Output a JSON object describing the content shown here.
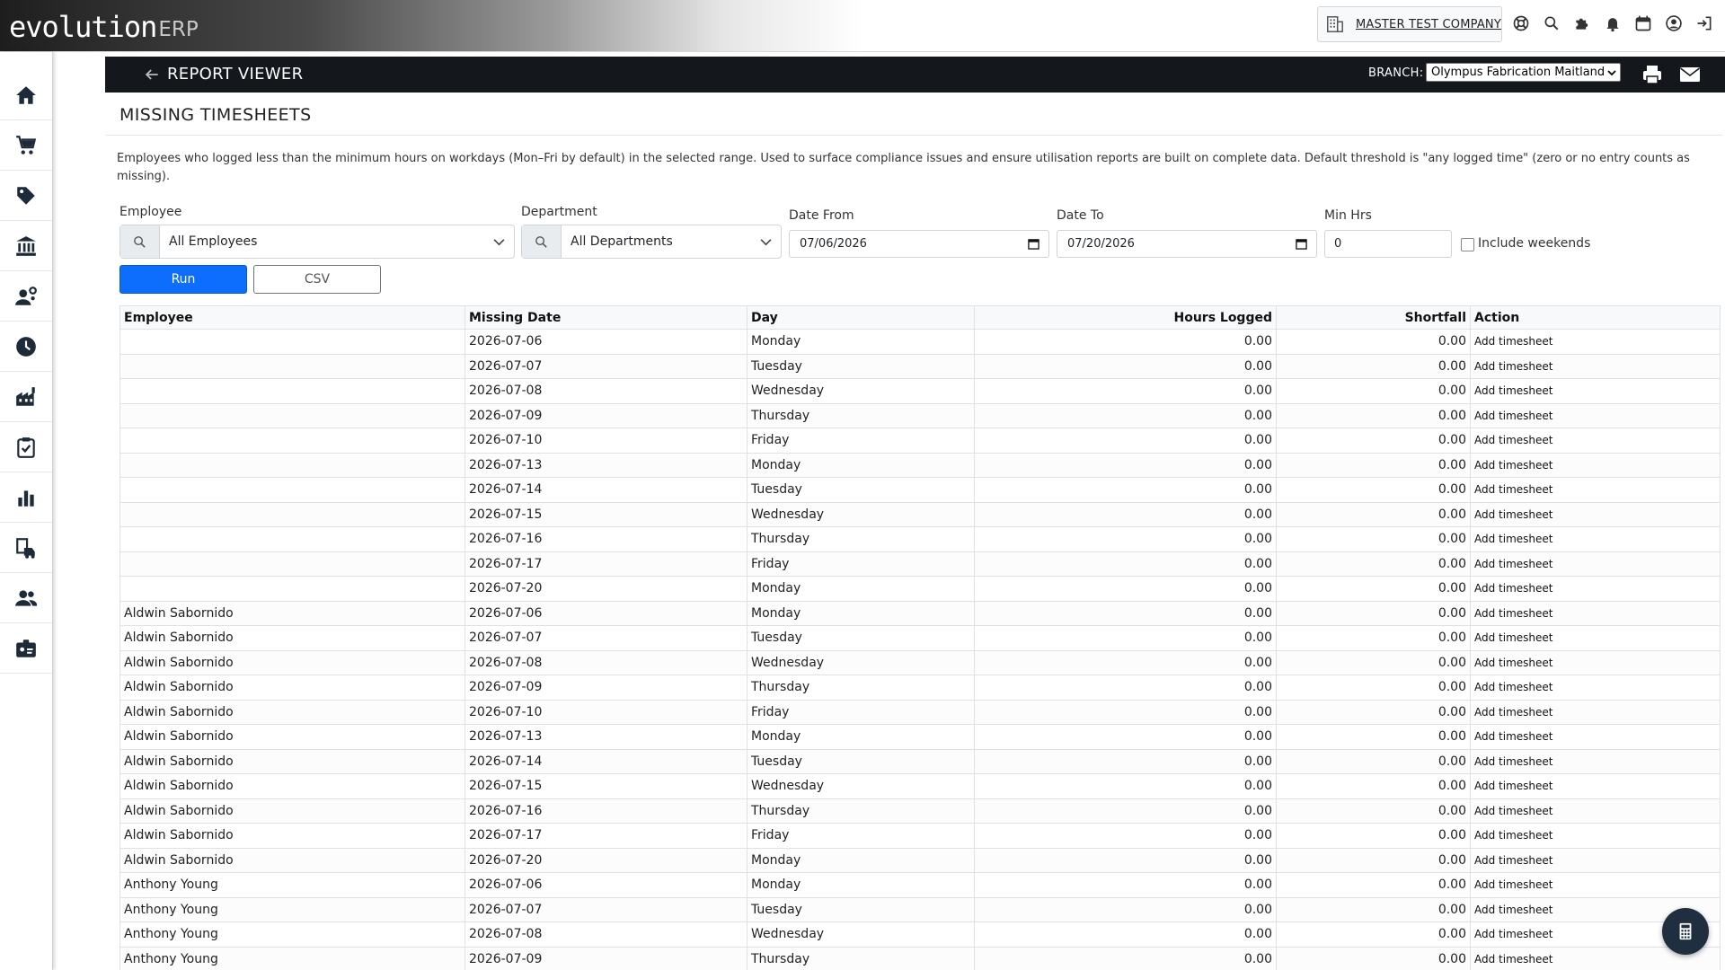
{
  "app": {
    "logo_main": "evolution",
    "logo_suffix": "ERP",
    "company": "MASTER TEST COMPANY"
  },
  "header": {
    "title": "REPORT VIEWER",
    "branch_label": "BRANCH:",
    "branch_value": "Olympus Fabrication Maitland"
  },
  "report": {
    "title": "MISSING TIMESHEETS",
    "description": "Employees who logged less than the minimum hours on workdays (Mon–Fri by default) in the selected range. Used to surface compliance issues and ensure utilisation reports are built on complete data. Default threshold is \"any logged time\" (zero or no entry counts as missing)."
  },
  "filters": {
    "employee_label": "Employee",
    "employee_value": "All Employees",
    "department_label": "Department",
    "department_value": "All Departments",
    "date_from_label": "Date From",
    "date_from_value": "07/06/2026",
    "date_to_label": "Date To",
    "date_to_value": "07/20/2026",
    "min_hrs_label": "Min Hrs",
    "min_hrs_value": "0",
    "include_weekends_label": "Include weekends",
    "include_weekends_checked": false,
    "run_label": "Run",
    "csv_label": "CSV"
  },
  "table": {
    "columns": [
      "Employee",
      "Missing Date",
      "Day",
      "Hours Logged",
      "Shortfall",
      "Action"
    ],
    "rows": [
      [
        "",
        "2026-07-06",
        "Monday",
        "0.00",
        "0.00",
        "Add timesheet"
      ],
      [
        "",
        "2026-07-07",
        "Tuesday",
        "0.00",
        "0.00",
        "Add timesheet"
      ],
      [
        "",
        "2026-07-08",
        "Wednesday",
        "0.00",
        "0.00",
        "Add timesheet"
      ],
      [
        "",
        "2026-07-09",
        "Thursday",
        "0.00",
        "0.00",
        "Add timesheet"
      ],
      [
        "",
        "2026-07-10",
        "Friday",
        "0.00",
        "0.00",
        "Add timesheet"
      ],
      [
        "",
        "2026-07-13",
        "Monday",
        "0.00",
        "0.00",
        "Add timesheet"
      ],
      [
        "",
        "2026-07-14",
        "Tuesday",
        "0.00",
        "0.00",
        "Add timesheet"
      ],
      [
        "",
        "2026-07-15",
        "Wednesday",
        "0.00",
        "0.00",
        "Add timesheet"
      ],
      [
        "",
        "2026-07-16",
        "Thursday",
        "0.00",
        "0.00",
        "Add timesheet"
      ],
      [
        "",
        "2026-07-17",
        "Friday",
        "0.00",
        "0.00",
        "Add timesheet"
      ],
      [
        "",
        "2026-07-20",
        "Monday",
        "0.00",
        "0.00",
        "Add timesheet"
      ],
      [
        "Aldwin Sabornido",
        "2026-07-06",
        "Monday",
        "0.00",
        "0.00",
        "Add timesheet"
      ],
      [
        "Aldwin Sabornido",
        "2026-07-07",
        "Tuesday",
        "0.00",
        "0.00",
        "Add timesheet"
      ],
      [
        "Aldwin Sabornido",
        "2026-07-08",
        "Wednesday",
        "0.00",
        "0.00",
        "Add timesheet"
      ],
      [
        "Aldwin Sabornido",
        "2026-07-09",
        "Thursday",
        "0.00",
        "0.00",
        "Add timesheet"
      ],
      [
        "Aldwin Sabornido",
        "2026-07-10",
        "Friday",
        "0.00",
        "0.00",
        "Add timesheet"
      ],
      [
        "Aldwin Sabornido",
        "2026-07-13",
        "Monday",
        "0.00",
        "0.00",
        "Add timesheet"
      ],
      [
        "Aldwin Sabornido",
        "2026-07-14",
        "Tuesday",
        "0.00",
        "0.00",
        "Add timesheet"
      ],
      [
        "Aldwin Sabornido",
        "2026-07-15",
        "Wednesday",
        "0.00",
        "0.00",
        "Add timesheet"
      ],
      [
        "Aldwin Sabornido",
        "2026-07-16",
        "Thursday",
        "0.00",
        "0.00",
        "Add timesheet"
      ],
      [
        "Aldwin Sabornido",
        "2026-07-17",
        "Friday",
        "0.00",
        "0.00",
        "Add timesheet"
      ],
      [
        "Aldwin Sabornido",
        "2026-07-20",
        "Monday",
        "0.00",
        "0.00",
        "Add timesheet"
      ],
      [
        "Anthony Young",
        "2026-07-06",
        "Monday",
        "0.00",
        "0.00",
        "Add timesheet"
      ],
      [
        "Anthony Young",
        "2026-07-07",
        "Tuesday",
        "0.00",
        "0.00",
        "Add timesheet"
      ],
      [
        "Anthony Young",
        "2026-07-08",
        "Wednesday",
        "0.00",
        "0.00",
        "Add timesheet"
      ],
      [
        "Anthony Young",
        "2026-07-09",
        "Thursday",
        "0.00",
        "0.00",
        "Add timesheet"
      ]
    ]
  },
  "icons": {
    "top": [
      "building-icon",
      "help-icon",
      "search-icon",
      "puzzle-icon",
      "bell-icon",
      "calendar-icon",
      "user-icon",
      "logout-icon"
    ],
    "sidebar": [
      "home-icon",
      "cart-icon",
      "tag-icon",
      "bank-icon",
      "people-gear-icon",
      "clock-icon",
      "factory-icon",
      "clipboard-check-icon",
      "chart-icon",
      "dispatch-icon",
      "users-icon",
      "id-card-icon"
    ],
    "floating": "calculator-icon"
  },
  "colors": {
    "accent": "#0d6efd",
    "header_bar": "#14181d",
    "sidebar_icon": "#1d2a3a"
  }
}
